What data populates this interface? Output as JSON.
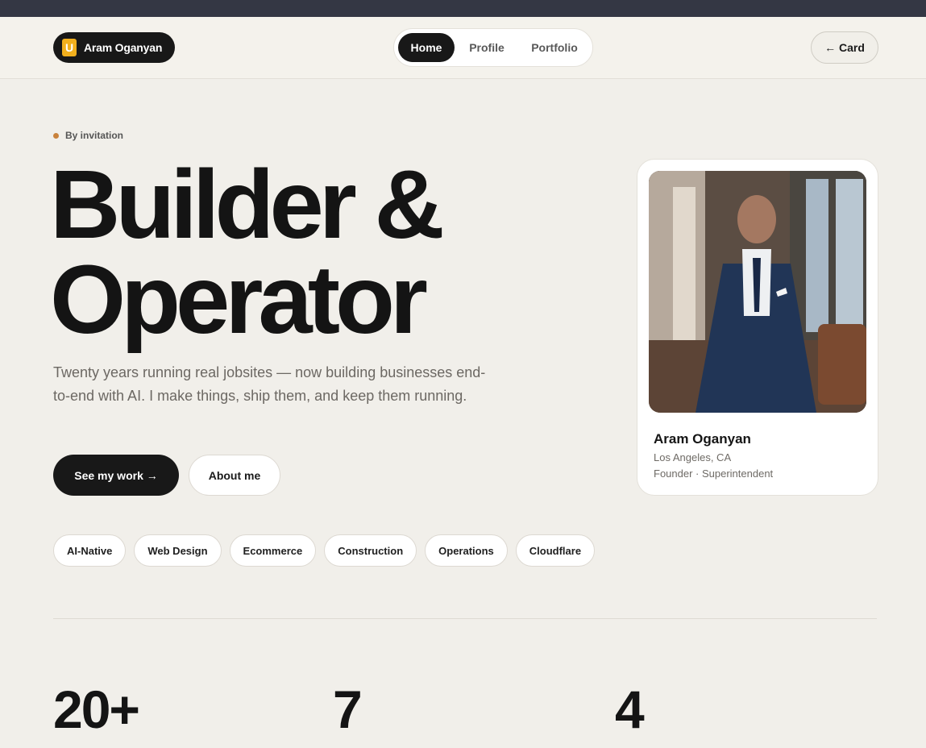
{
  "header": {
    "brand_name": "Aram Oganyan",
    "brand_logo": "U",
    "nav": [
      {
        "label": "Home",
        "active": true
      },
      {
        "label": "Profile",
        "active": false
      },
      {
        "label": "Portfolio",
        "active": false
      }
    ],
    "card_button": "← Card"
  },
  "hero": {
    "eyebrow": "By invitation",
    "headline_line1": "Builder &",
    "headline_line2": "Operator",
    "intro": "Twenty years running real jobsites — now building businesses end-to-end with AI. I make things, ship them, and keep them running.",
    "primary_button": "See my work  →",
    "secondary_button": "About me",
    "tags": [
      "AI-Native",
      "Web Design",
      "Ecommerce",
      "Construction",
      "Operations",
      "Cloudflare"
    ]
  },
  "profile_card": {
    "name": "Aram Oganyan",
    "location": "Los Angeles, CA",
    "role": "Founder · Superintendent"
  },
  "stats": [
    "20+",
    "7",
    "4"
  ],
  "colors": {
    "background": "#f1efea",
    "dark": "#181818",
    "accent_dot": "#c9823c",
    "logo": "#f2b01e"
  }
}
